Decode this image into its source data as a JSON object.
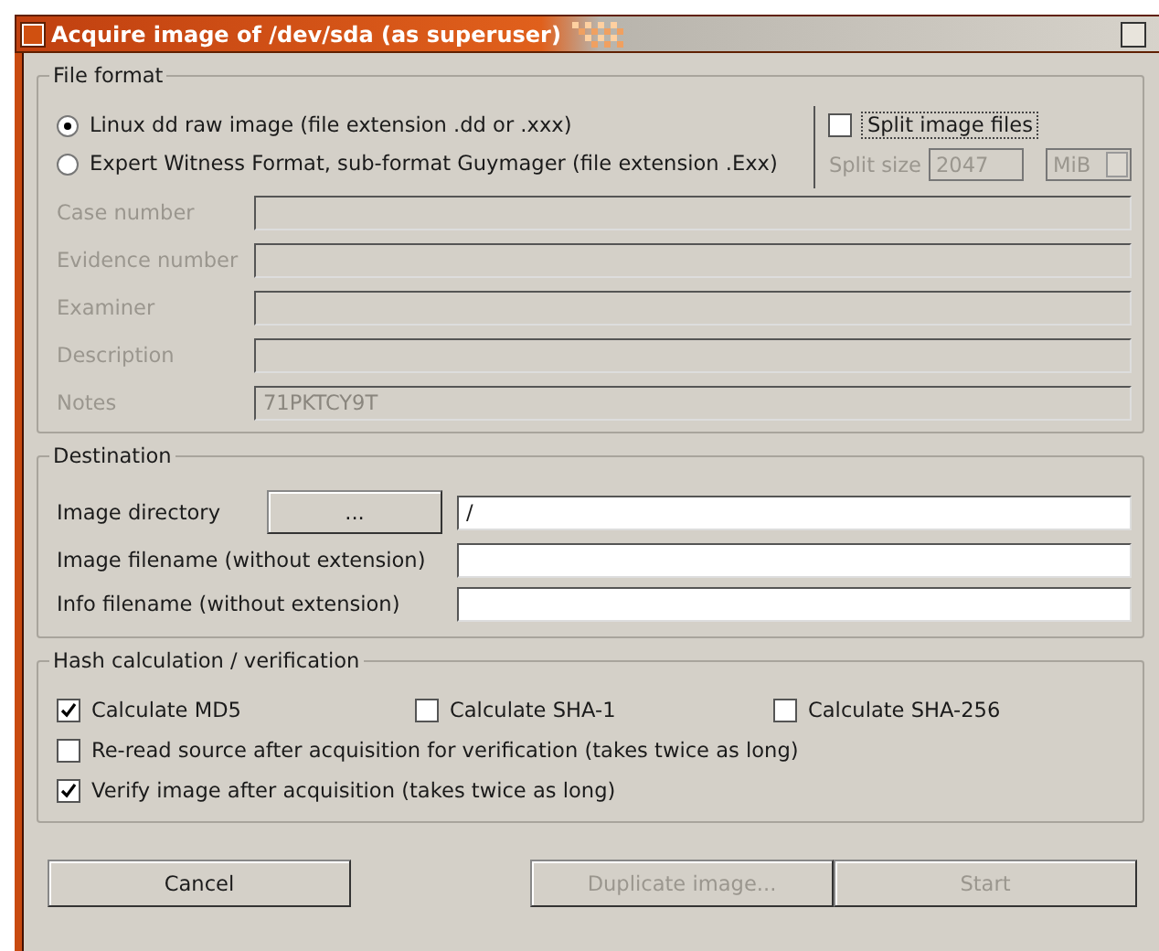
{
  "window": {
    "title": "Acquire image of /dev/sda (as superuser)"
  },
  "file_format": {
    "title": "File format",
    "formats": [
      {
        "label": "Linux dd raw image (file extension .dd or .xxx)",
        "selected": true
      },
      {
        "label": "Expert Witness Format, sub-format Guymager (file extension .Exx)",
        "selected": false
      }
    ],
    "split": {
      "label": "Split image files",
      "checked": false,
      "size_label": "Split size",
      "size_value": "2047",
      "unit": "MiB",
      "disabled": true
    },
    "fields": [
      {
        "label": "Case number",
        "disabled": true
      },
      {
        "label": "Evidence number",
        "disabled": true
      },
      {
        "label": "Examiner",
        "disabled": true
      },
      {
        "label": "Description",
        "disabled": true
      },
      {
        "label": "Notes",
        "value": "71PKTCY9T",
        "disabled": true
      }
    ]
  },
  "destination": {
    "title": "Destination",
    "directory": {
      "label": "Image directory",
      "browse": "...",
      "value": "/"
    },
    "fields": [
      {
        "label": "Image filename (without extension)"
      },
      {
        "label": "Info filename (without extension)"
      }
    ]
  },
  "hash": {
    "title": "Hash calculation / verification",
    "options": [
      {
        "label": "Calculate MD5",
        "checked": true,
        "kind": "column"
      },
      {
        "label": "Calculate SHA-1",
        "checked": false,
        "kind": "column"
      },
      {
        "label": "Calculate SHA-256",
        "checked": false,
        "kind": "column"
      },
      {
        "label": "Re-read source after acquisition for verification (takes twice as long)",
        "checked": false,
        "kind": "line"
      },
      {
        "label": "Verify image after acquisition (takes twice as long)",
        "checked": true,
        "kind": "line"
      }
    ]
  },
  "buttons": [
    {
      "label": "Cancel",
      "disabled": false,
      "kind": "left"
    },
    {
      "label": "Duplicate image...",
      "disabled": true,
      "kind": "right"
    },
    {
      "label": "Start",
      "disabled": true,
      "kind": "right"
    }
  ]
}
